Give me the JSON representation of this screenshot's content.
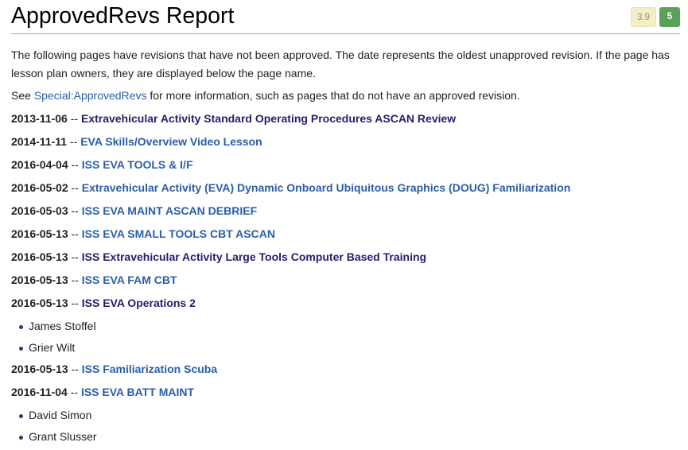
{
  "header": {
    "title": "ApprovedRevs Report",
    "badge_score": "3.9",
    "badge_count": "5"
  },
  "intro": {
    "text": "The following pages have revisions that have not been approved. The date represents the oldest unapproved revision. If the page has lesson plan owners, they are displayed below the page name.",
    "see_prefix": "See ",
    "see_link": "Special:ApprovedRevs",
    "see_suffix": " for more information, such as pages that do not have an approved revision."
  },
  "separator": "--",
  "entries": [
    {
      "date": "2013-11-06",
      "title": "Extravehicular Activity Standard Operating Procedures ASCAN Review",
      "visited": true,
      "owners": []
    },
    {
      "date": "2014-11-11",
      "title": "EVA Skills/Overview Video Lesson",
      "visited": false,
      "owners": []
    },
    {
      "date": "2016-04-04",
      "title": "ISS EVA TOOLS & I/F",
      "visited": false,
      "owners": []
    },
    {
      "date": "2016-05-02",
      "title": "Extravehicular Activity (EVA) Dynamic Onboard Ubiquitous Graphics (DOUG) Familiarization",
      "visited": false,
      "owners": []
    },
    {
      "date": "2016-05-03",
      "title": "ISS EVA MAINT ASCAN DEBRIEF",
      "visited": false,
      "owners": []
    },
    {
      "date": "2016-05-13",
      "title": "ISS EVA SMALL TOOLS CBT ASCAN",
      "visited": false,
      "owners": []
    },
    {
      "date": "2016-05-13",
      "title": "ISS Extravehicular Activity Large Tools Computer Based Training",
      "visited": true,
      "owners": []
    },
    {
      "date": "2016-05-13",
      "title": "ISS EVA FAM CBT",
      "visited": false,
      "owners": []
    },
    {
      "date": "2016-05-13",
      "title": "ISS EVA Operations 2",
      "visited": true,
      "owners": [
        "James Stoffel",
        "Grier Wilt"
      ]
    },
    {
      "date": "2016-05-13",
      "title": "ISS Familiarization Scuba",
      "visited": false,
      "owners": []
    },
    {
      "date": "2016-11-04",
      "title": "ISS EVA BATT MAINT",
      "visited": false,
      "owners": [
        "David Simon",
        "Grant Slusser"
      ]
    }
  ],
  "colors": {
    "link": "#2a5ea8",
    "link_visited": "#2a1a6e",
    "badge_green": "#5aa25a",
    "badge_muted": "#f2efc8"
  }
}
